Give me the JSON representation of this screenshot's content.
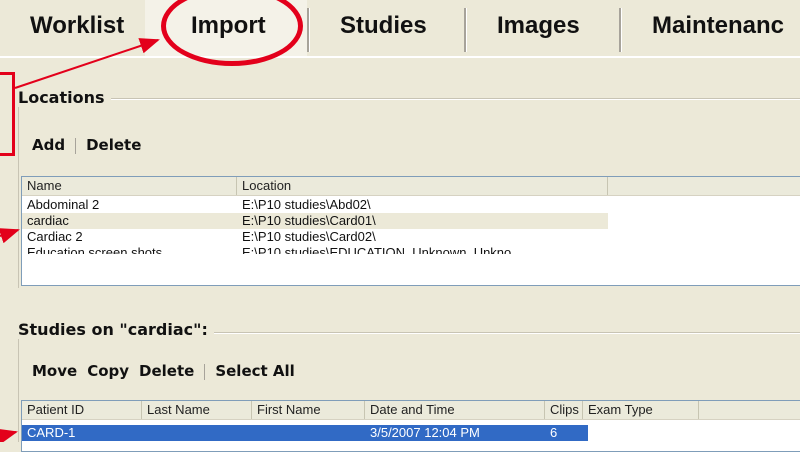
{
  "tabs": [
    {
      "label": "Worklist"
    },
    {
      "label": "Import"
    },
    {
      "label": "Studies"
    },
    {
      "label": "Images"
    },
    {
      "label": "Maintenanc"
    }
  ],
  "locations": {
    "title": "Locations",
    "toolbar": {
      "add": "Add",
      "delete": "Delete"
    },
    "columns": [
      "Name",
      "Location"
    ],
    "rows": [
      {
        "name": "Abdominal 2",
        "location": "E:\\P10 studies\\Abd02\\"
      },
      {
        "name": "cardiac",
        "location": "E:\\P10 studies\\Card01\\"
      },
      {
        "name": "Cardiac 2",
        "location": "E:\\P10 studies\\Card02\\"
      },
      {
        "name": "Education screen shots",
        "location": "E:\\P10 studies\\EDUCATION_Unknown_Unkno"
      }
    ]
  },
  "studies": {
    "title": "Studies on \"cardiac\":",
    "toolbar": {
      "move": "Move",
      "copy": "Copy",
      "delete": "Delete",
      "select_all": "Select All"
    },
    "columns": [
      "Patient ID",
      "Last Name",
      "First Name",
      "Date and Time",
      "Clips",
      "Exam Type"
    ],
    "rows": [
      {
        "patient_id": "CARD-1",
        "last_name": "",
        "first_name": "",
        "date_time": "3/5/2007 12:04 PM",
        "clips": "6",
        "exam_type": ""
      }
    ]
  },
  "colors": {
    "annotation": "#e3001b",
    "selection": "#316ac5",
    "window_bg": "#ece9d8"
  }
}
